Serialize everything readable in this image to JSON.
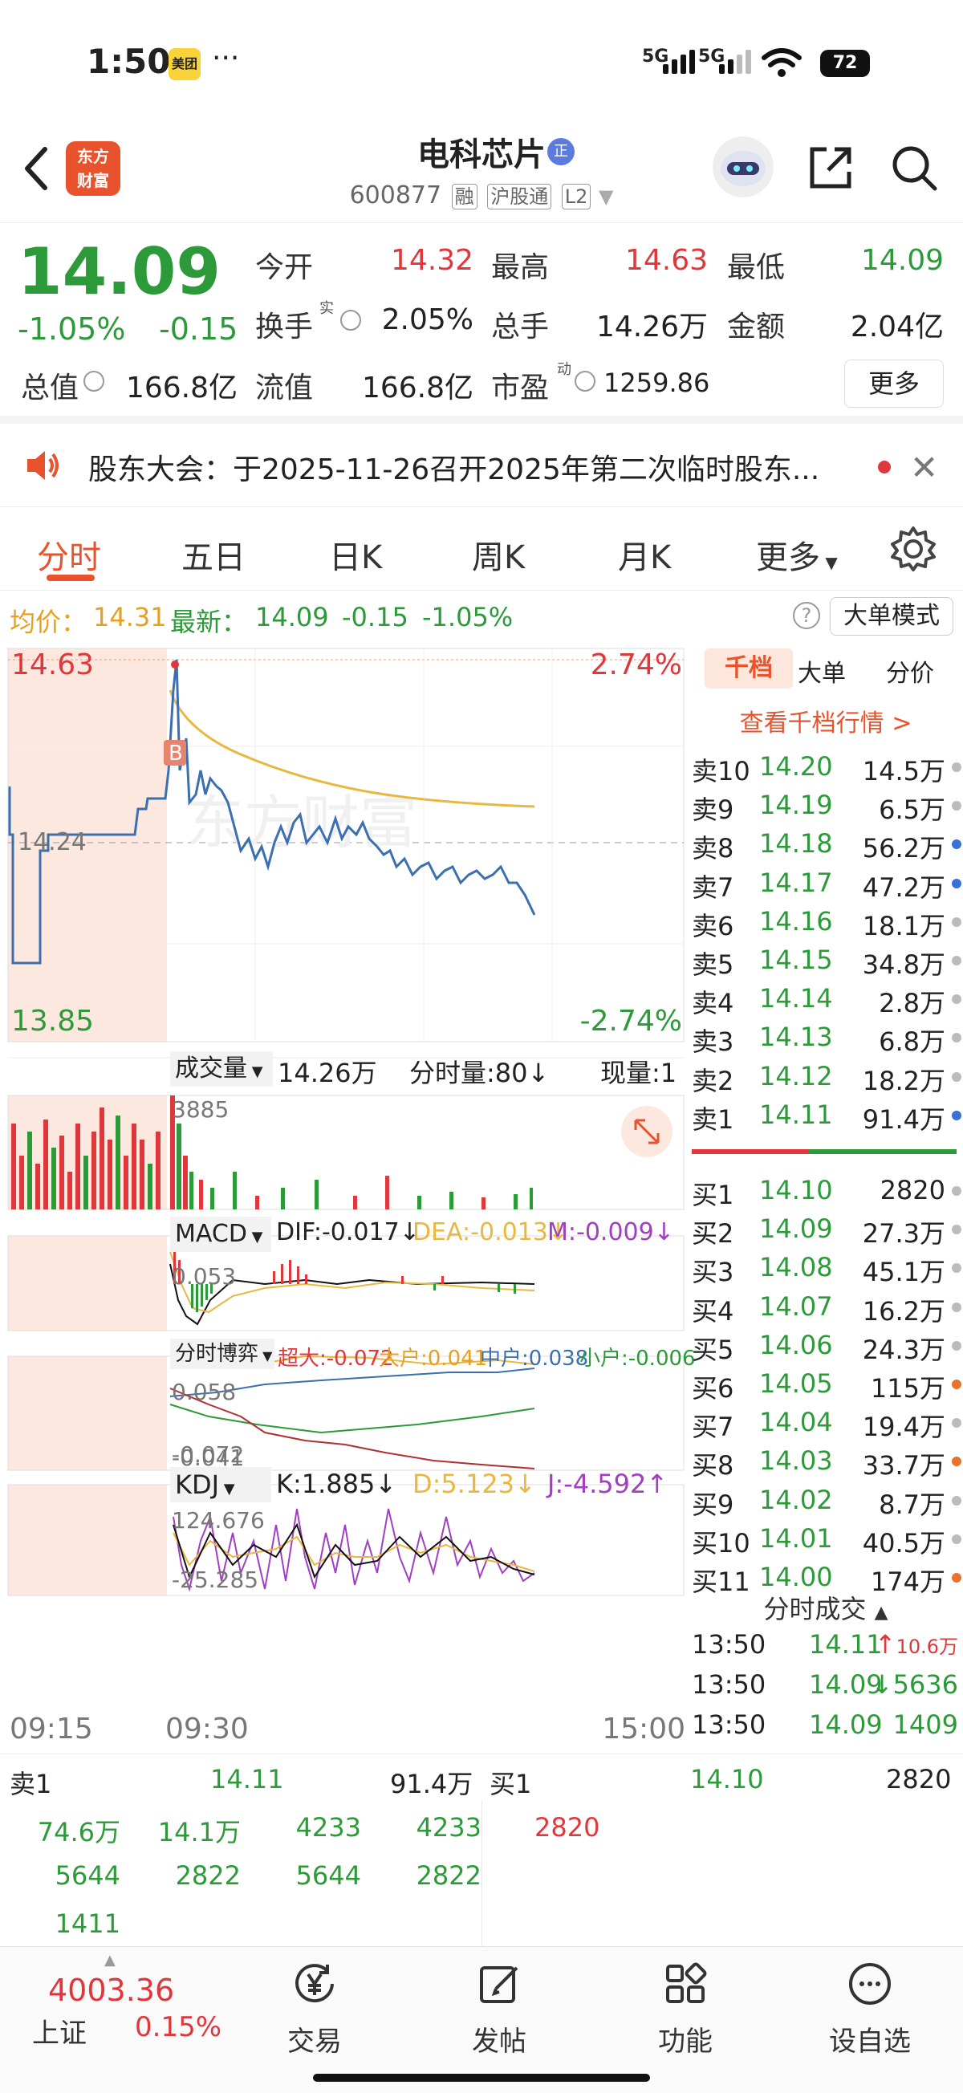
{
  "status_bar": {
    "time": "1:50",
    "meituan": "美团",
    "dots": "···",
    "sig1": "5G",
    "sig2": "5G",
    "battery": "72"
  },
  "header": {
    "title": "电科芯片",
    "badge": "正",
    "code": "600877",
    "tags": [
      "融",
      "沪股通",
      "L2"
    ],
    "logo_line1": "东方",
    "logo_line2": "财富"
  },
  "quote": {
    "price": "14.09",
    "pct": "-1.05%",
    "chg": "-0.15",
    "fields": {
      "open_label": "今开",
      "open": "14.32",
      "high_label": "最高",
      "high": "14.63",
      "low_label": "最低",
      "low": "14.09",
      "turnover_label": "换手",
      "turnover_sup": "实",
      "turnover": "2.05%",
      "volume_label": "总手",
      "volume": "14.26万",
      "amount_label": "金额",
      "amount": "2.04亿",
      "mcap_label": "总值",
      "mcap": "166.8亿",
      "float_label": "流值",
      "float": "166.8亿",
      "pe_label": "市盈",
      "pe_sup": "动",
      "pe": "1259.86"
    },
    "more": "更多"
  },
  "notice": {
    "text": "股东大会：于2025-11-26召开2025年第二次临时股东..."
  },
  "tabs": [
    "分时",
    "五日",
    "日K",
    "周K",
    "月K",
    "更多"
  ],
  "avg_bar": {
    "avg_label": "均价：",
    "avg": "14.31",
    "latest_label": "最新：",
    "latest": "14.09",
    "chg": "-0.15",
    "pct": "-1.05%",
    "help": "?",
    "big_order": "大单模式"
  },
  "chart": {
    "price_high": "14.63",
    "price_low": "13.85",
    "pct_high": "2.74%",
    "pct_low": "-2.74%",
    "base": "14.24",
    "marker": "B",
    "vol_label": "成交量",
    "vol_total": "14.26万",
    "vol_min_label": "分时量:80↓",
    "vol_now_label": "现量:1",
    "vol_max": "3885",
    "macd_label": "MACD",
    "dif": "DIF:-0.017↓",
    "dea": "DEA:-0.013↓",
    "m": "M:-0.009↓",
    "macd_max": "0.053",
    "macd_min": "-0.041",
    "game_label": "分时博弈",
    "g_super": "超大:-0.072",
    "g_big": "大户:0.041",
    "g_mid": "中户:0.038",
    "g_small": "小户:-0.006",
    "game_max": "0.058",
    "game_min": "-0.072",
    "kdj_label": "KDJ",
    "k": "K:1.885↓",
    "d": "D:5.123↓",
    "j": "J:-4.592↑",
    "kdj_max": "124.676",
    "kdj_min": "-25.285",
    "t_start": "09:15",
    "t_open": "09:30",
    "t_end": "15:00",
    "watermark": "东方财富"
  },
  "chart_data": {
    "type": "line",
    "title": "",
    "x": [
      "09:15",
      "09:30",
      "15:00"
    ],
    "ylim": [
      13.85,
      14.63
    ],
    "base": 14.24,
    "series": [
      {
        "name": "均价",
        "values": [
          14.31
        ]
      },
      {
        "name": "最新",
        "values": [
          14.09
        ]
      }
    ]
  },
  "book": {
    "tabs": [
      "千档",
      "大单",
      "分价"
    ],
    "link": "查看千档行情 >",
    "asks": [
      {
        "n": "卖10",
        "p": "14.20",
        "v": "14.5万",
        "dot": "gray"
      },
      {
        "n": "卖9",
        "p": "14.19",
        "v": "6.5万",
        "dot": "gray"
      },
      {
        "n": "卖8",
        "p": "14.18",
        "v": "56.2万",
        "dot": "blue"
      },
      {
        "n": "卖7",
        "p": "14.17",
        "v": "47.2万",
        "dot": "blue"
      },
      {
        "n": "卖6",
        "p": "14.16",
        "v": "18.1万",
        "dot": "gray"
      },
      {
        "n": "卖5",
        "p": "14.15",
        "v": "34.8万",
        "dot": "gray"
      },
      {
        "n": "卖4",
        "p": "14.14",
        "v": "2.8万",
        "dot": "gray"
      },
      {
        "n": "卖3",
        "p": "14.13",
        "v": "6.8万",
        "dot": "gray"
      },
      {
        "n": "卖2",
        "p": "14.12",
        "v": "18.2万",
        "dot": "gray"
      },
      {
        "n": "卖1",
        "p": "14.11",
        "v": "91.4万",
        "dot": "blue"
      }
    ],
    "bids": [
      {
        "n": "买1",
        "p": "14.10",
        "v": "2820",
        "dot": "gray"
      },
      {
        "n": "买2",
        "p": "14.09",
        "v": "27.3万",
        "dot": "gray"
      },
      {
        "n": "买3",
        "p": "14.08",
        "v": "45.1万",
        "dot": "gray"
      },
      {
        "n": "买4",
        "p": "14.07",
        "v": "16.2万",
        "dot": "gray"
      },
      {
        "n": "买5",
        "p": "14.06",
        "v": "24.3万",
        "dot": "gray"
      },
      {
        "n": "买6",
        "p": "14.05",
        "v": "115万",
        "dot": "orange"
      },
      {
        "n": "买7",
        "p": "14.04",
        "v": "19.4万",
        "dot": "gray"
      },
      {
        "n": "买8",
        "p": "14.03",
        "v": "33.7万",
        "dot": "orange"
      },
      {
        "n": "买9",
        "p": "14.02",
        "v": "8.7万",
        "dot": "gray"
      },
      {
        "n": "买10",
        "p": "14.01",
        "v": "40.5万",
        "dot": "gray"
      },
      {
        "n": "买11",
        "p": "14.00",
        "v": "174万",
        "dot": "orange"
      }
    ],
    "ticks_header": "分时成交",
    "ticks": [
      {
        "t": "13:50",
        "p": "14.11",
        "v": "10.6万",
        "dir": "↑"
      },
      {
        "t": "13:50",
        "p": "14.09",
        "v": "5636",
        "dir": "↓"
      },
      {
        "t": "13:50",
        "p": "14.09",
        "v": "1409",
        "dir": ""
      }
    ]
  },
  "bottom_book": {
    "sell_label": "卖1",
    "sell_price": "14.11",
    "sell_vol": "91.4万",
    "buy_label": "买1",
    "buy_price": "14.10",
    "buy_vol": "2820",
    "sell_queue": [
      "74.6万",
      "14.1万",
      "4233",
      "4233",
      "5644",
      "2822",
      "5644",
      "2822",
      "1411"
    ],
    "buy_queue": [
      "2820"
    ]
  },
  "nav": {
    "index_value": "4003.36",
    "index_name": "上证",
    "index_pct": "0.15%",
    "items": [
      "交易",
      "发帖",
      "功能",
      "设自选"
    ]
  }
}
